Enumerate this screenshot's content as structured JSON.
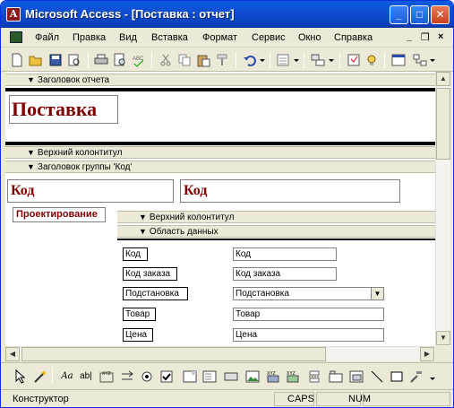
{
  "window": {
    "title": "Microsoft Access - [Поставка : отчет]",
    "app_icon": "access-key-icon",
    "minimize": "_",
    "maximize": "□",
    "close": "✕"
  },
  "menu": {
    "items": [
      "Файл",
      "Правка",
      "Вид",
      "Вставка",
      "Формат",
      "Сервис",
      "Окно",
      "Справка"
    ],
    "mdi_minimize": "_",
    "mdi_restore": "❐",
    "mdi_close": "×"
  },
  "report": {
    "sections": {
      "report_header": "Заголовок отчета",
      "page_header": "Верхний колонтитул",
      "group_header": "Заголовок группы 'Код'",
      "sub_page_header": "Верхний колонтитул",
      "detail": "Область данных"
    },
    "title_label": "Поставка",
    "group_label": "Код",
    "group_field": "Код",
    "subreport_label": "Проектирование",
    "fields": [
      {
        "label": "Код",
        "value": "Код",
        "combo": false
      },
      {
        "label": "Код заказа",
        "value": "Код заказа",
        "combo": false
      },
      {
        "label": "Подстановка",
        "value": "Подстановка",
        "combo": true
      },
      {
        "label": "Товар",
        "value": "Товар",
        "combo": false
      },
      {
        "label": "Цена",
        "value": "Цена",
        "combo": false
      }
    ]
  },
  "statusbar": {
    "mode": "Конструктор",
    "caps": "CAPS",
    "num": "NUM"
  },
  "colors": {
    "title_bar": "#0a3fb8",
    "label_text": "#800000",
    "section_bar": "#ece9d8"
  }
}
